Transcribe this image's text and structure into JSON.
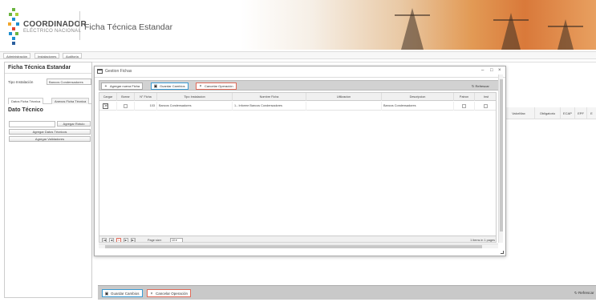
{
  "header": {
    "logo_main": "COORDINADOR",
    "logo_sub": "ELÉCTRICO NACIONAL",
    "title": "Ficha Técnica Estandar"
  },
  "nav": {
    "items": [
      "Administración",
      "Instalaciones",
      "Auditoria"
    ]
  },
  "left_panel": {
    "title": "Ficha Técnica Estandar",
    "tipo_label": "Tipo Instalación",
    "tipo_value": "Bancos Condensadores",
    "tabs": [
      "Datos Ficha Técnica",
      "Anexos Ficha Técnica"
    ],
    "dato_title": "Dato Técnico",
    "agregar_rotulo": "Agregar Rótulo",
    "agregar_datos": "Agregar Datos Técnicos",
    "agregar_validadores": "Agregar Validadores"
  },
  "background_grid": {
    "columns": [
      "ValorMax",
      "Obligatorio",
      "ECAP",
      "EPF",
      "E"
    ]
  },
  "bottom_toolbar": {
    "save": "Guardar Cambios",
    "cancel": "Cancelar Operación",
    "refresh": "Refrescar"
  },
  "modal": {
    "title": "Gestion Fichas",
    "controls": {
      "minimize": "–",
      "maximize": "□",
      "close": "×"
    },
    "toolbar": {
      "add": "Agregar nueva Ficha",
      "save": "Guardar Cambios",
      "cancel": "Cancelar Operación",
      "refresh": "Refrescar"
    },
    "grid": {
      "columns": [
        "Cargar",
        "Borrar",
        "N° Ficha",
        "Tipo Instalacion",
        "Nombre Ficha",
        "Utilizacion",
        "Descripcion",
        "Patron",
        "Inst"
      ],
      "rows": [
        {
          "n_ficha": "103",
          "tipo_instalacion": "Bancos Condensadores",
          "nombre_ficha": "1.- Informe Bancos Condensadores",
          "utilizacion": "",
          "descripcion": "Bancos Condensadores"
        }
      ]
    },
    "pager": {
      "first": "|◀",
      "prev": "◀",
      "current": "1",
      "next": "▶",
      "last": "▶|",
      "page_size_label": "Page size:",
      "page_size": "10",
      "info": "1 items in 1 pages"
    }
  },
  "colors": {
    "save_border": "#3a9bd4",
    "cancel_border": "#e06b5a",
    "toolbar_bg": "#c9c9c9"
  }
}
